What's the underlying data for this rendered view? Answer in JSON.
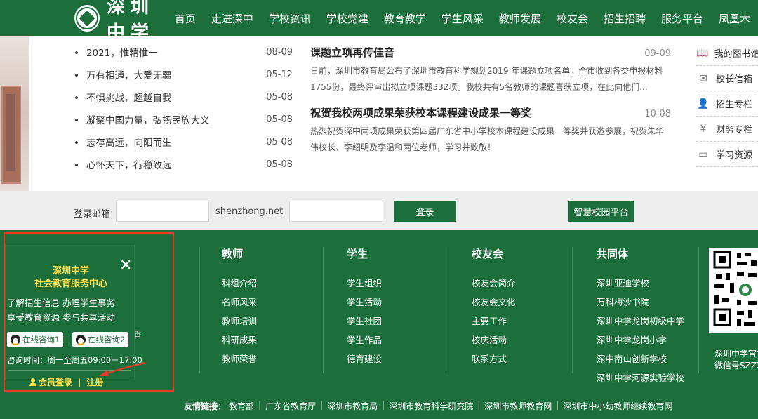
{
  "header": {
    "logo_text": "深圳中学",
    "nav": [
      "首页",
      "走进深中",
      "学校资讯",
      "学校党建",
      "教育教学",
      "学生风采",
      "教师发展",
      "校友会",
      "招生招聘",
      "服务平台",
      "凤凰木"
    ]
  },
  "news_list": [
    {
      "title": "2021，惟精惟一",
      "date": "08-09"
    },
    {
      "title": "万有相通，大爱无疆",
      "date": "05-12"
    },
    {
      "title": "不惧挑战，超越自我",
      "date": "05-08"
    },
    {
      "title": "凝聚中国力量，弘扬民族大义",
      "date": "05-08"
    },
    {
      "title": "志存高远，向阳而生",
      "date": "05-08"
    },
    {
      "title": "心怀天下，行稳致远",
      "date": "05-08"
    }
  ],
  "articles": [
    {
      "title": "课题立项再传佳音",
      "date": "09-09",
      "summary": "日前，深圳市教育局公布了深圳市教育科学规划2019 年课题立项名单。全市收到各类申报材料1755份，最终评审出拟立项课题332项。我校共有5名教师的课题喜获立项，在此向他们..."
    },
    {
      "title": "祝贺我校两项成果荣获校本课程建设成果一等奖",
      "date": "10-08",
      "summary": "热烈祝贺深中两项成果荣获第四届广东省中小学校本课程建设成果一等奖并获邀参展，祝贺朱华伟校长、李绍明及李温和两位老师，学习并致敬！"
    }
  ],
  "side_links": [
    {
      "label": "我的图书馆",
      "icon": "book-icon"
    },
    {
      "label": "校长信箱",
      "icon": "mail-icon"
    },
    {
      "label": "招生专栏",
      "icon": "user-icon"
    },
    {
      "label": "财务专栏",
      "icon": "yen-icon"
    },
    {
      "label": "学习资源",
      "icon": "monitor-icon"
    }
  ],
  "login": {
    "label": "登录邮箱",
    "domain": "shenzhong.net",
    "login_button": "登录",
    "platform_button": "智慧校园平台"
  },
  "footer": {
    "columns": [
      {
        "title": "教师",
        "items": [
          "科组介绍",
          "名师风采",
          "教师培训",
          "科研成果",
          "教师荣誉"
        ]
      },
      {
        "title": "学生",
        "items": [
          "学生组织",
          "学生活动",
          "学生社团",
          "学生作品",
          "德育建设"
        ]
      },
      {
        "title": "校友会",
        "items": [
          "校友会简介",
          "校友会文化",
          "主要工作",
          "校庆活动",
          "联系方式"
        ]
      },
      {
        "title": "共同体",
        "items": [
          "深圳亚迪学校",
          "万科梅沙书院",
          "深圳中学龙岗初级中学",
          "深圳中学龙岗小学",
          "深中南山创新学校",
          "深圳中学河源实验学校"
        ]
      }
    ],
    "qr_caption": [
      "深圳中学官方",
      "微信号SZZX"
    ],
    "partial_char": "香",
    "friend_links_label": "友情链接：",
    "friend_links": [
      "教育部",
      "广东省教育厅",
      "深圳市教育局",
      "深圳市教育科学研究院",
      "深圳市教师教育网",
      "深圳市中小幼教师继续教育网"
    ]
  },
  "popup": {
    "title_line1": "深圳中学",
    "title_line2": "社会教育服务中心",
    "line1": "了解招生信息   办理学生事务",
    "line2": "享受教育资源   参与共享活动",
    "consult1": "在线咨询1",
    "consult2": "在线咨询2",
    "hours": "咨询时间：周一至周五09:00－17:00",
    "member_login": "会员登录",
    "register": "注册",
    "close": "✕"
  },
  "colors": {
    "brand_green": "#1c6e3a",
    "highlight_red": "#e53a2a",
    "popup_title_yellow": "#ffe14d"
  }
}
